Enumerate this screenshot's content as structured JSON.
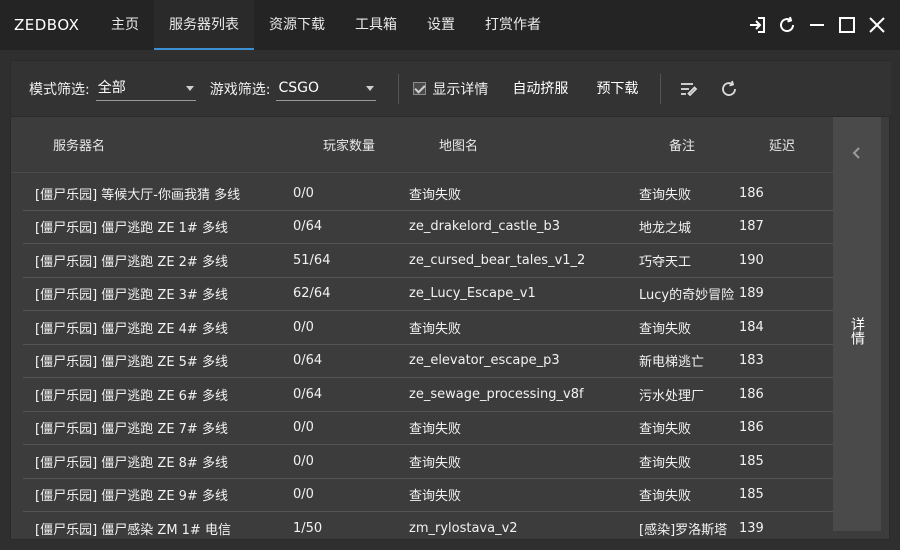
{
  "app": {
    "name": "ZEDBOX"
  },
  "tabs": [
    {
      "label": "主页"
    },
    {
      "label": "服务器列表"
    },
    {
      "label": "资源下载"
    },
    {
      "label": "工具箱"
    },
    {
      "label": "设置"
    },
    {
      "label": "打赏作者"
    }
  ],
  "active_tab_index": 1,
  "window_controls": [
    "login-icon",
    "refresh-icon",
    "minimize-icon",
    "maximize-icon",
    "close-icon"
  ],
  "toolbar": {
    "mode_filter_label": "模式筛选:",
    "mode_filter_value": "全部",
    "game_filter_label": "游戏筛选:",
    "game_filter_value": "CSGO",
    "show_details_label": "显示详情",
    "show_details_checked": true,
    "auto_join_label": "自动挤服",
    "predownload_label": "预下载"
  },
  "table": {
    "headers": {
      "name": "服务器名",
      "players": "玩家数量",
      "map": "地图名",
      "note": "备注",
      "ping": "延迟"
    },
    "rows": [
      {
        "name": "[僵尸乐园] 等候大厅-你画我猜 多线",
        "players": "0/0",
        "map": "查询失败",
        "note": "查询失败",
        "ping": "186"
      },
      {
        "name": "[僵尸乐园] 僵尸逃跑 ZE 1# 多线",
        "players": "0/64",
        "map": "ze_drakelord_castle_b3",
        "note": "地龙之城",
        "ping": "187"
      },
      {
        "name": "[僵尸乐园] 僵尸逃跑 ZE 2# 多线",
        "players": "51/64",
        "map": "ze_cursed_bear_tales_v1_2",
        "note": "巧夺天工",
        "ping": "190"
      },
      {
        "name": "[僵尸乐园] 僵尸逃跑 ZE 3# 多线",
        "players": "62/64",
        "map": "ze_Lucy_Escape_v1",
        "note": "Lucy的奇妙冒险",
        "ping": "189"
      },
      {
        "name": "[僵尸乐园] 僵尸逃跑 ZE 4# 多线",
        "players": "0/0",
        "map": "查询失败",
        "note": "查询失败",
        "ping": "184"
      },
      {
        "name": "[僵尸乐园] 僵尸逃跑 ZE 5# 多线",
        "players": "0/64",
        "map": "ze_elevator_escape_p3",
        "note": "新电梯逃亡",
        "ping": "183"
      },
      {
        "name": "[僵尸乐园] 僵尸逃跑 ZE 6# 多线",
        "players": "0/64",
        "map": "ze_sewage_processing_v8f",
        "note": "污水处理厂",
        "ping": "186"
      },
      {
        "name": "[僵尸乐园] 僵尸逃跑 ZE 7# 多线",
        "players": "0/0",
        "map": "查询失败",
        "note": "查询失败",
        "ping": "186"
      },
      {
        "name": "[僵尸乐园] 僵尸逃跑 ZE 8# 多线",
        "players": "0/0",
        "map": "查询失败",
        "note": "查询失败",
        "ping": "185"
      },
      {
        "name": "[僵尸乐园] 僵尸逃跑 ZE 9# 多线",
        "players": "0/0",
        "map": "查询失败",
        "note": "查询失败",
        "ping": "185"
      },
      {
        "name": "[僵尸乐园] 僵尸感染 ZM 1# 电信",
        "players": "1/50",
        "map": "zm_rylostava_v2",
        "note": "[感染]罗洛斯塔",
        "ping": "139"
      }
    ]
  },
  "side_panel": {
    "detail_label": "详情"
  },
  "colors": {
    "accent": "#3d8fd1",
    "titlebar": "#242424",
    "panel": "#3c3c3c",
    "toolbar": "#333333",
    "side": "#4a4a4a"
  }
}
